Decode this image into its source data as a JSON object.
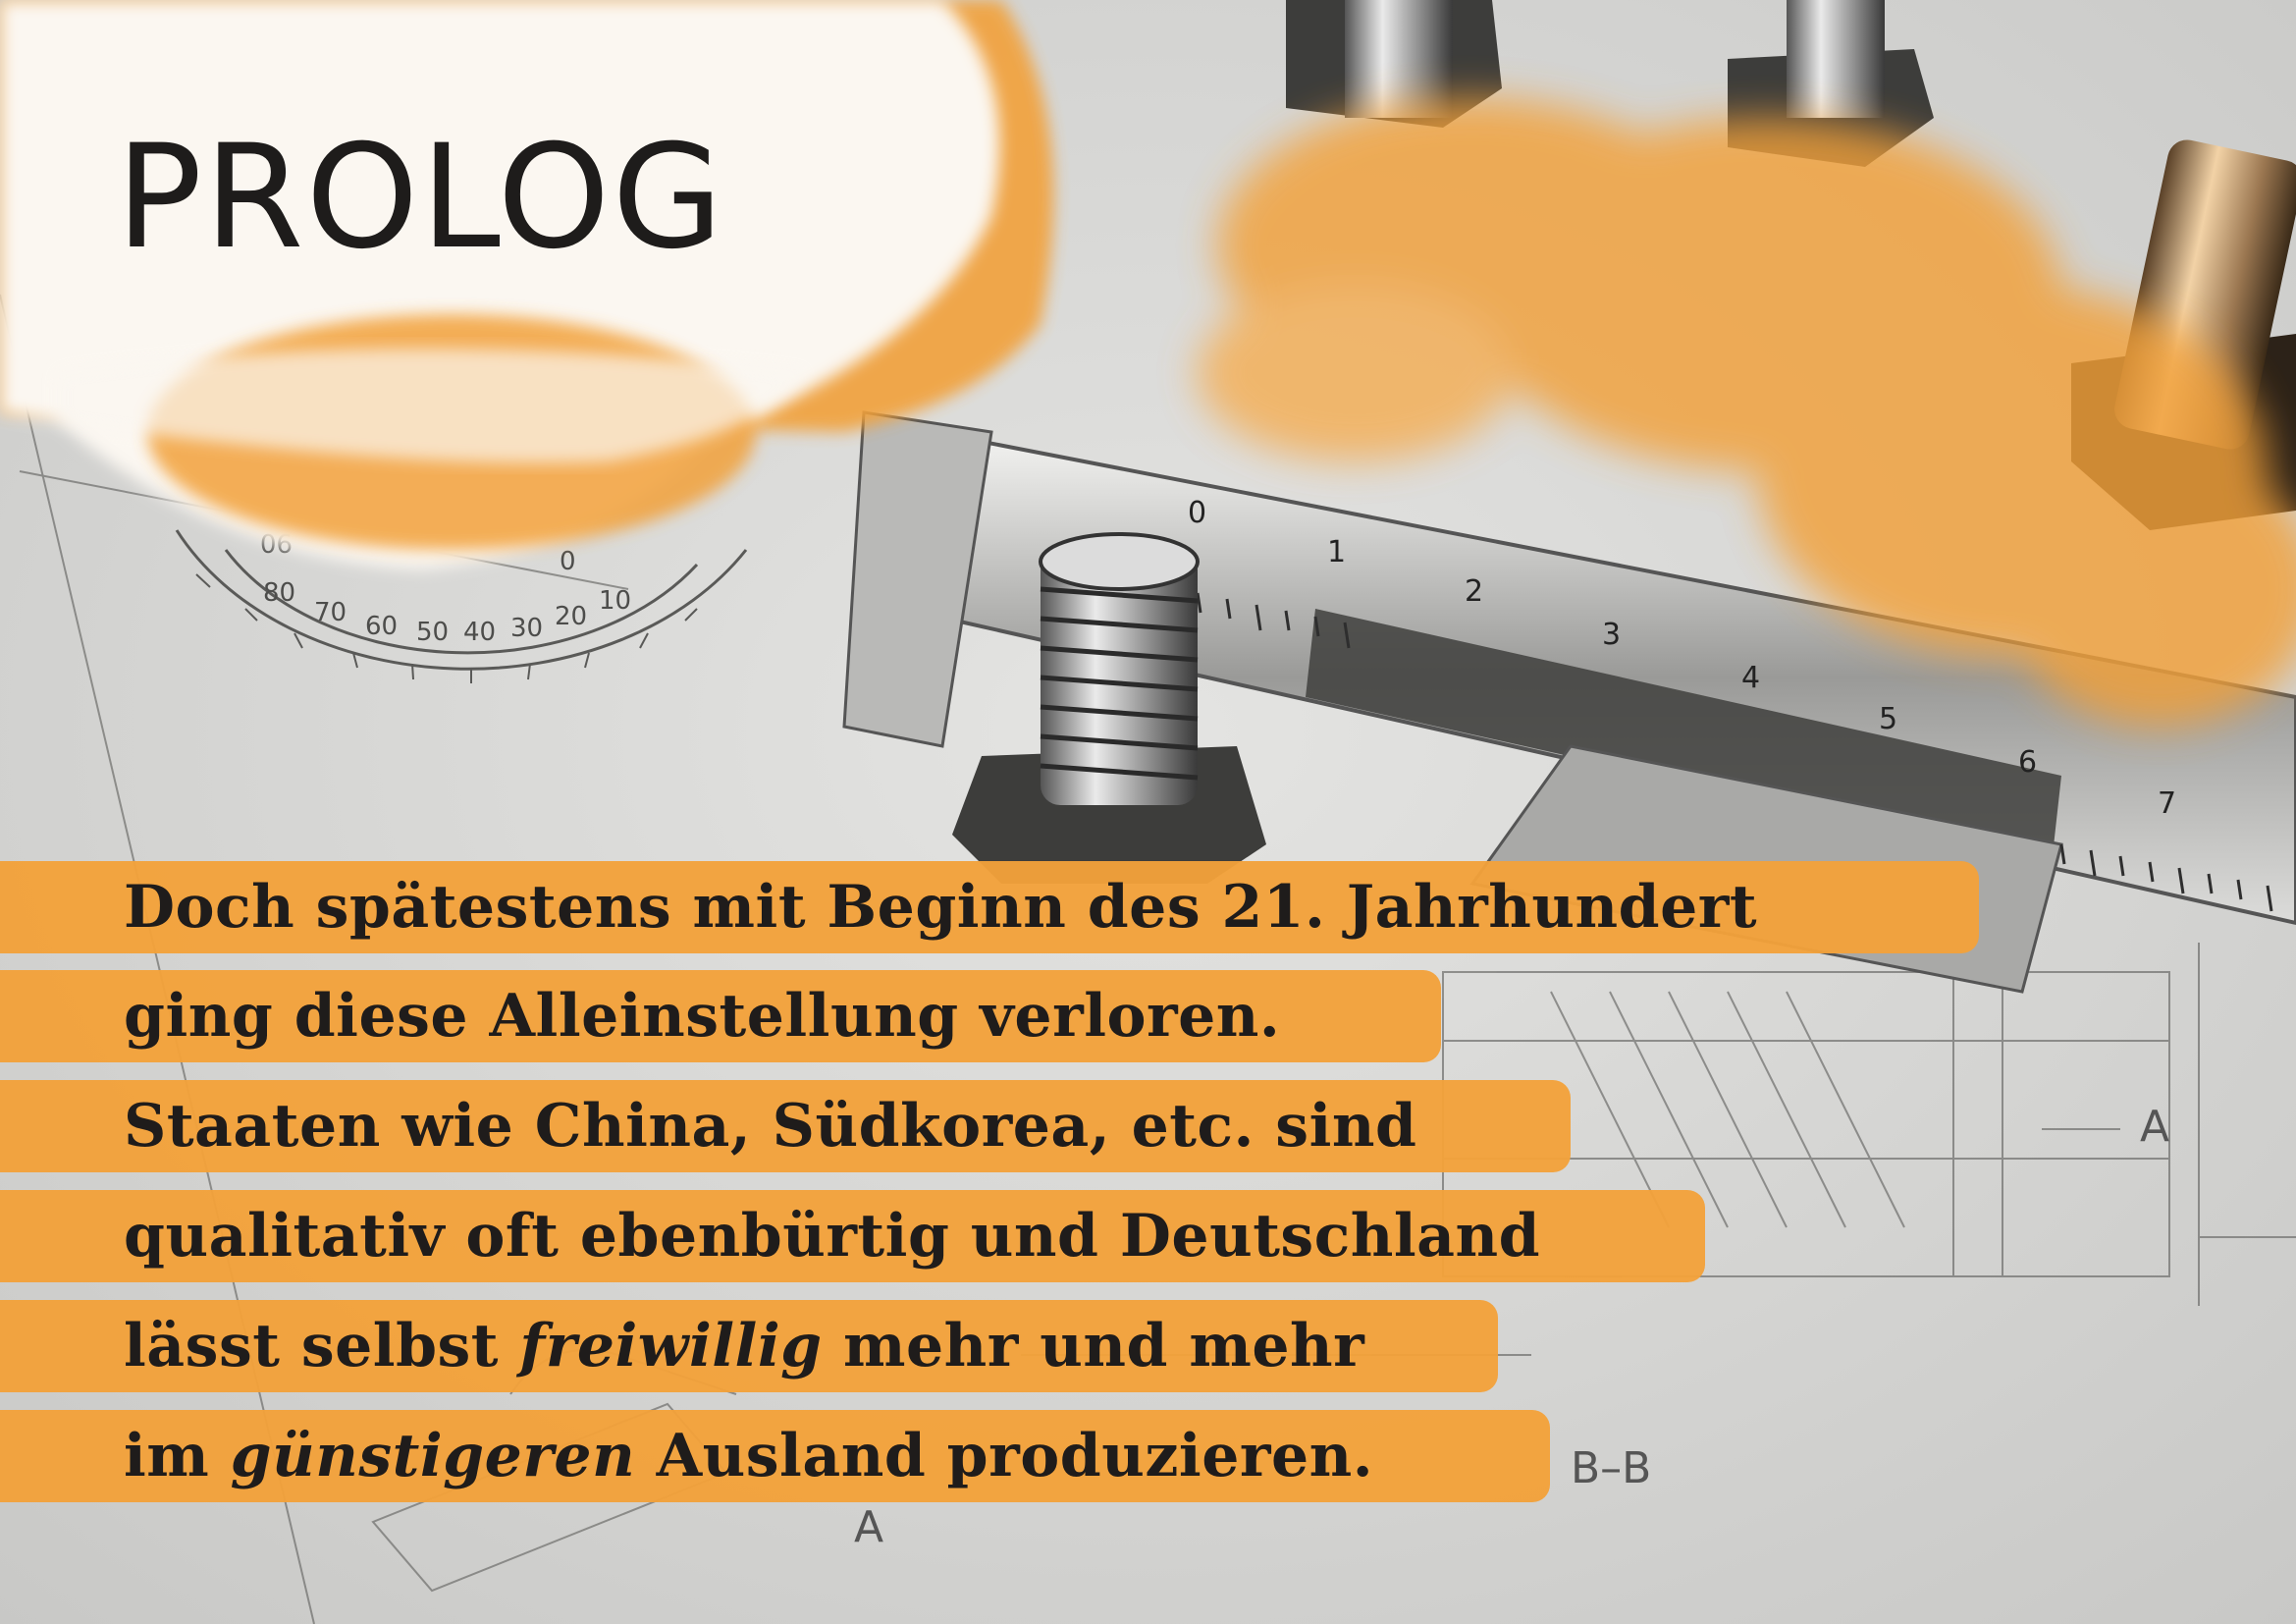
{
  "title": "PROLOG",
  "colors": {
    "accent_orange": "#f2a13a",
    "paper_gray": "#d7d7d5",
    "text_dark": "#1f1c1b"
  },
  "illustration": {
    "description_icons": [
      "protractor-icon",
      "caliper-icon",
      "bolt-icon"
    ],
    "protractor_labels": [
      "0",
      "10",
      "20",
      "30",
      "40",
      "50",
      "60",
      "70",
      "80",
      "90"
    ],
    "caliper_scale": [
      "0",
      "1",
      "2",
      "3",
      "4",
      "5",
      "6",
      "7"
    ],
    "drawing_labels": [
      "A",
      "B–B",
      "A"
    ]
  },
  "body": {
    "lines": [
      {
        "parts": [
          {
            "text": "Doch spätestens mit Beginn des 21. Jahrhundert",
            "italic": false
          }
        ]
      },
      {
        "parts": [
          {
            "text": "ging diese Alleinstellung verloren.",
            "italic": false
          }
        ]
      },
      {
        "parts": [
          {
            "text": "Staaten wie China, Südkorea, etc. sind",
            "italic": false
          }
        ]
      },
      {
        "parts": [
          {
            "text": "qualitativ oft ebenbürtig und Deutschland",
            "italic": false
          }
        ]
      },
      {
        "parts": [
          {
            "text": "lässt selbst ",
            "italic": false
          },
          {
            "text": "freiwillig",
            "italic": true
          },
          {
            "text": " mehr und mehr",
            "italic": false
          }
        ]
      },
      {
        "parts": [
          {
            "text": "im ",
            "italic": false
          },
          {
            "text": "günstigeren",
            "italic": true
          },
          {
            "text": " Ausland produzieren.",
            "italic": false
          }
        ]
      }
    ]
  }
}
